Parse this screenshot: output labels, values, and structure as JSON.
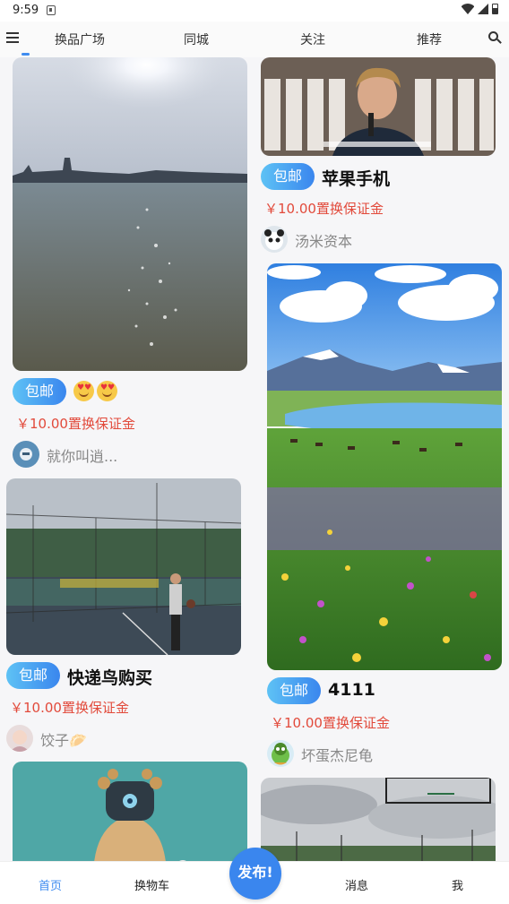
{
  "status_bar": {
    "time": "9:59"
  },
  "top_nav": {
    "tabs": [
      "换品广场",
      "同城",
      "关注",
      "推荐"
    ],
    "active_tab": "换品广场"
  },
  "feed": [
    {
      "badge": "包邮",
      "title": "😍😍",
      "price": "￥10.00置换保证金",
      "user": "就你叫逍...",
      "photo": "lake-sunset"
    },
    {
      "badge": "包邮",
      "title": "苹果手机",
      "price": "￥10.00置换保证金",
      "user": "汤米资本",
      "photo": "man-at-microphone"
    },
    {
      "badge": "包邮",
      "title": "快递鸟购买",
      "price": "￥10.00置换保证金",
      "user": "饺子🥟",
      "photo": "sports-court"
    },
    {
      "badge": "包邮",
      "title": "4111",
      "price": "￥10.00置换保证金",
      "user": "坏蛋杰尼龟",
      "photo": "meadow-mountains"
    },
    {
      "photo": "octopus-toy"
    },
    {
      "photo": "basketball-hoop"
    }
  ],
  "bottom_nav": {
    "items": [
      "首页",
      "换物车",
      "消息",
      "我"
    ],
    "active": "首页",
    "publish_label": "发布!"
  },
  "colors": {
    "accent": "#3a86ee",
    "price": "#e24a3b",
    "badge_gradient": [
      "#5ec2f5",
      "#3a86ee"
    ]
  }
}
